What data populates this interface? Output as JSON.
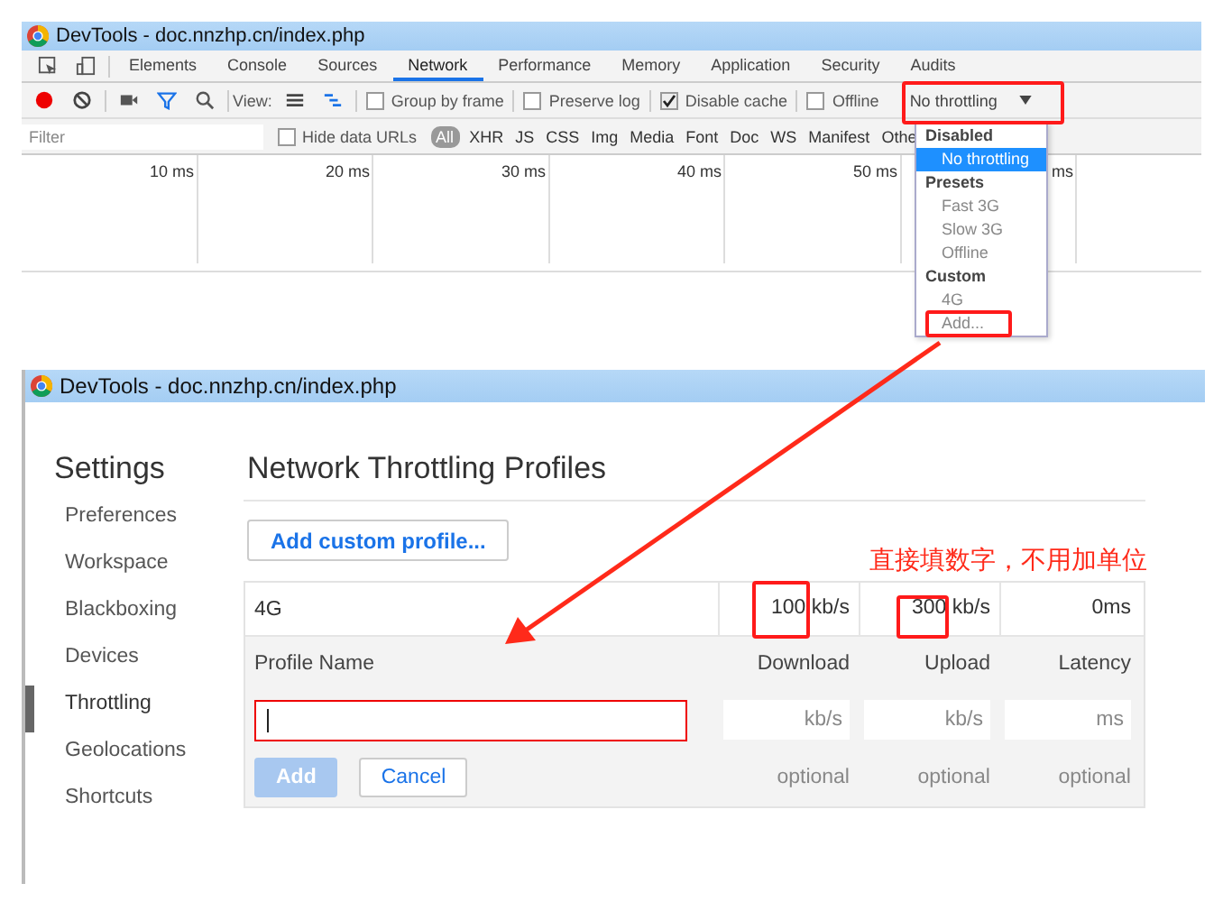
{
  "top_window": {
    "title": "DevTools - doc.nnzhp.cn/index.php",
    "tabs": [
      {
        "label": "Elements",
        "selected": false
      },
      {
        "label": "Console",
        "selected": false
      },
      {
        "label": "Sources",
        "selected": false
      },
      {
        "label": "Network",
        "selected": true
      },
      {
        "label": "Performance",
        "selected": false
      },
      {
        "label": "Memory",
        "selected": false
      },
      {
        "label": "Application",
        "selected": false
      },
      {
        "label": "Security",
        "selected": false
      },
      {
        "label": "Audits",
        "selected": false
      }
    ],
    "toolbar": {
      "view_label": "View:",
      "checkboxes": [
        {
          "label": "Group by frame",
          "checked": false
        },
        {
          "label": "Preserve log",
          "checked": false
        },
        {
          "label": "Disable cache",
          "checked": true
        },
        {
          "label": "Offline",
          "checked": false
        }
      ],
      "throttling": "No throttling"
    },
    "filter": {
      "placeholder": "Filter",
      "hide_data_urls": {
        "label": "Hide data URLs",
        "checked": false
      },
      "types": [
        {
          "label": "All",
          "selected": true
        },
        {
          "label": "XHR",
          "selected": false
        },
        {
          "label": "JS",
          "selected": false
        },
        {
          "label": "CSS",
          "selected": false
        },
        {
          "label": "Img",
          "selected": false
        },
        {
          "label": "Media",
          "selected": false
        },
        {
          "label": "Font",
          "selected": false
        },
        {
          "label": "Doc",
          "selected": false
        },
        {
          "label": "WS",
          "selected": false
        },
        {
          "label": "Manifest",
          "selected": false
        },
        {
          "label": "Othe",
          "selected": false
        }
      ]
    },
    "timeline": [
      "10 ms",
      "20 ms",
      "30 ms",
      "40 ms",
      "50 ms",
      "ms"
    ],
    "dropdown": [
      {
        "kind": "header",
        "label": "Disabled"
      },
      {
        "kind": "option",
        "label": "No throttling",
        "selected": true
      },
      {
        "kind": "header",
        "label": "Presets"
      },
      {
        "kind": "option",
        "label": "Fast 3G",
        "selected": false
      },
      {
        "kind": "option",
        "label": "Slow 3G",
        "selected": false
      },
      {
        "kind": "option",
        "label": "Offline",
        "selected": false
      },
      {
        "kind": "header",
        "label": "Custom"
      },
      {
        "kind": "option",
        "label": "4G",
        "selected": false
      },
      {
        "kind": "option",
        "label": "Add...",
        "selected": false
      }
    ]
  },
  "bottom_window": {
    "title": "DevTools - doc.nnzhp.cn/index.php",
    "sidebar": {
      "title": "Settings",
      "items": [
        {
          "label": "Preferences",
          "selected": false
        },
        {
          "label": "Workspace",
          "selected": false
        },
        {
          "label": "Blackboxing",
          "selected": false
        },
        {
          "label": "Devices",
          "selected": false
        },
        {
          "label": "Throttling",
          "selected": true
        },
        {
          "label": "Geolocations",
          "selected": false
        },
        {
          "label": "Shortcuts",
          "selected": false
        }
      ]
    },
    "heading": "Network Throttling Profiles",
    "add_button": "Add custom profile...",
    "profiles": [
      {
        "name": "4G",
        "download": "100",
        "download_unit": "kb/s",
        "upload": "300",
        "upload_unit": "kb/s",
        "latency": "0ms"
      }
    ],
    "editor": {
      "columns": [
        "Profile Name",
        "Download",
        "Upload",
        "Latency"
      ],
      "fields": [
        {
          "placeholder": "kb/s",
          "hint": "optional"
        },
        {
          "placeholder": "kb/s",
          "hint": "optional"
        },
        {
          "placeholder": "ms",
          "hint": "optional"
        }
      ],
      "add": "Add",
      "cancel": "Cancel"
    }
  },
  "annotation": "直接填数字，不用加单位"
}
